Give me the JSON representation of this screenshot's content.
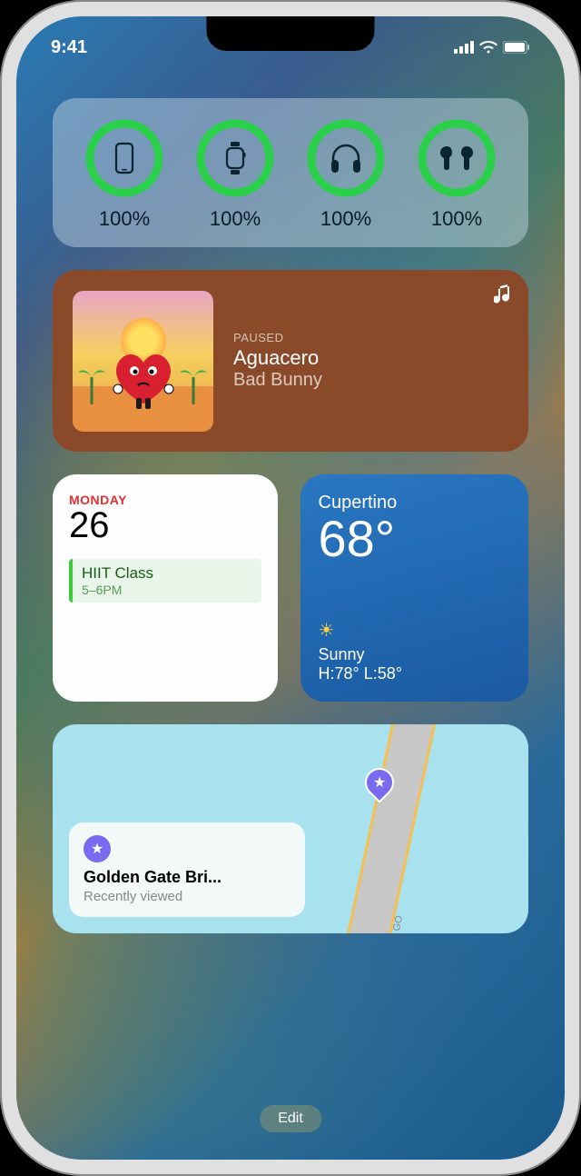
{
  "status": {
    "time": "9:41"
  },
  "batteries": {
    "items": [
      {
        "device": "phone",
        "pct": "100%"
      },
      {
        "device": "watch",
        "pct": "100%"
      },
      {
        "device": "headphones",
        "pct": "100%"
      },
      {
        "device": "airpods",
        "pct": "100%"
      }
    ]
  },
  "music": {
    "status": "PAUSED",
    "title": "Aguacero",
    "artist": "Bad Bunny"
  },
  "calendar": {
    "day": "MONDAY",
    "date": "26",
    "event_title": "HIIT Class",
    "event_time": "5–6PM"
  },
  "weather": {
    "location": "Cupertino",
    "temp": "68°",
    "condition": "Sunny",
    "hilo": "H:78° L:58°"
  },
  "maps": {
    "card_title": "Golden Gate Bri...",
    "card_sub": "Recently viewed",
    "road_label": "GO"
  },
  "edit_label": "Edit"
}
